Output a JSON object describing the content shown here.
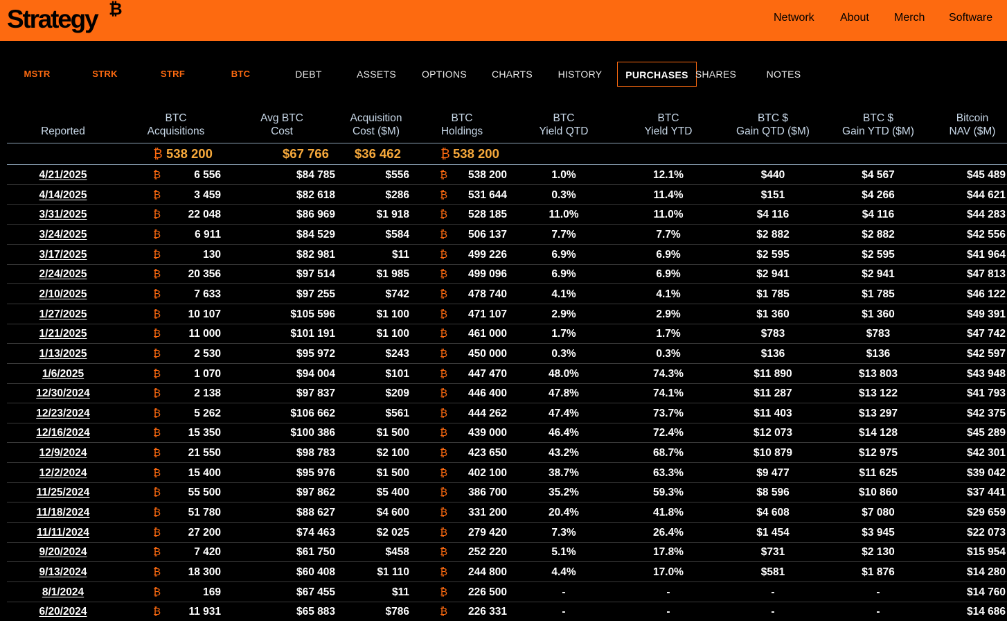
{
  "header": {
    "logo": "Strategy",
    "logo_mark": "₿",
    "nav": [
      "Network",
      "About",
      "Merch",
      "Software"
    ]
  },
  "tabs": [
    "MSTR",
    "STRK",
    "STRF",
    "BTC",
    "DEBT",
    "ASSETS",
    "OPTIONS",
    "CHARTS",
    "HISTORY",
    "PURCHASES",
    "SHARES",
    "NOTES"
  ],
  "active_tab": "PURCHASES",
  "columns": [
    {
      "l1": "",
      "l2": "Reported"
    },
    {
      "l1": "BTC",
      "l2": "Acquisitions"
    },
    {
      "l1": "Avg BTC",
      "l2": "Cost"
    },
    {
      "l1": "Acquisition",
      "l2": "Cost ($M)"
    },
    {
      "l1": "BTC",
      "l2": "Holdings"
    },
    {
      "l1": "BTC",
      "l2": "Yield QTD"
    },
    {
      "l1": "BTC",
      "l2": "Yield YTD"
    },
    {
      "l1": "BTC $",
      "l2": "Gain QTD ($M)"
    },
    {
      "l1": "BTC $",
      "l2": "Gain YTD ($M)"
    },
    {
      "l1": "Bitcoin",
      "l2": "NAV ($M)"
    }
  ],
  "totals": {
    "acquisitions": "538 200",
    "avg_cost": "$67 766",
    "acq_cost": "$36 462",
    "holdings": "538 200"
  },
  "btc_symbol": "₿",
  "rows": [
    [
      "4/21/2025",
      "6 556",
      "$84 785",
      "$556",
      "538 200",
      "1.0%",
      "12.1%",
      "$440",
      "$4 567",
      "$45 489"
    ],
    [
      "4/14/2025",
      "3 459",
      "$82 618",
      "$286",
      "531 644",
      "0.3%",
      "11.4%",
      "$151",
      "$4 266",
      "$44 621"
    ],
    [
      "3/31/2025",
      "22 048",
      "$86 969",
      "$1 918",
      "528 185",
      "11.0%",
      "11.0%",
      "$4 116",
      "$4 116",
      "$44 283"
    ],
    [
      "3/24/2025",
      "6 911",
      "$84 529",
      "$584",
      "506 137",
      "7.7%",
      "7.7%",
      "$2 882",
      "$2 882",
      "$42 556"
    ],
    [
      "3/17/2025",
      "130",
      "$82 981",
      "$11",
      "499 226",
      "6.9%",
      "6.9%",
      "$2 595",
      "$2 595",
      "$41 964"
    ],
    [
      "2/24/2025",
      "20 356",
      "$97 514",
      "$1 985",
      "499 096",
      "6.9%",
      "6.9%",
      "$2 941",
      "$2 941",
      "$47 813"
    ],
    [
      "2/10/2025",
      "7 633",
      "$97 255",
      "$742",
      "478 740",
      "4.1%",
      "4.1%",
      "$1 785",
      "$1 785",
      "$46 122"
    ],
    [
      "1/27/2025",
      "10 107",
      "$105 596",
      "$1 100",
      "471 107",
      "2.9%",
      "2.9%",
      "$1 360",
      "$1 360",
      "$49 391"
    ],
    [
      "1/21/2025",
      "11 000",
      "$101 191",
      "$1 100",
      "461 000",
      "1.7%",
      "1.7%",
      "$783",
      "$783",
      "$47 742"
    ],
    [
      "1/13/2025",
      "2 530",
      "$95 972",
      "$243",
      "450 000",
      "0.3%",
      "0.3%",
      "$136",
      "$136",
      "$42 597"
    ],
    [
      "1/6/2025",
      "1 070",
      "$94 004",
      "$101",
      "447 470",
      "48.0%",
      "74.3%",
      "$11 890",
      "$13 803",
      "$43 948"
    ],
    [
      "12/30/2024",
      "2 138",
      "$97 837",
      "$209",
      "446 400",
      "47.8%",
      "74.1%",
      "$11 287",
      "$13 122",
      "$41 793"
    ],
    [
      "12/23/2024",
      "5 262",
      "$106 662",
      "$561",
      "444 262",
      "47.4%",
      "73.7%",
      "$11 403",
      "$13 297",
      "$42 375"
    ],
    [
      "12/16/2024",
      "15 350",
      "$100 386",
      "$1 500",
      "439 000",
      "46.4%",
      "72.4%",
      "$12 073",
      "$14 128",
      "$45 289"
    ],
    [
      "12/9/2024",
      "21 550",
      "$98 783",
      "$2 100",
      "423 650",
      "43.2%",
      "68.7%",
      "$10 879",
      "$12 975",
      "$42 301"
    ],
    [
      "12/2/2024",
      "15 400",
      "$95 976",
      "$1 500",
      "402 100",
      "38.7%",
      "63.3%",
      "$9 477",
      "$11 625",
      "$39 042"
    ],
    [
      "11/25/2024",
      "55 500",
      "$97 862",
      "$5 400",
      "386 700",
      "35.2%",
      "59.3%",
      "$8 596",
      "$10 860",
      "$37 441"
    ],
    [
      "11/18/2024",
      "51 780",
      "$88 627",
      "$4 600",
      "331 200",
      "20.4%",
      "41.8%",
      "$4 608",
      "$7 080",
      "$29 659"
    ],
    [
      "11/11/2024",
      "27 200",
      "$74 463",
      "$2 025",
      "279 420",
      "7.3%",
      "26.4%",
      "$1 454",
      "$3 945",
      "$22 073"
    ],
    [
      "9/20/2024",
      "7 420",
      "$61 750",
      "$458",
      "252 220",
      "5.1%",
      "17.8%",
      "$731",
      "$2 130",
      "$15 954"
    ],
    [
      "9/13/2024",
      "18 300",
      "$60 408",
      "$1 110",
      "244 800",
      "4.4%",
      "17.0%",
      "$581",
      "$1 876",
      "$14 280"
    ],
    [
      "8/1/2024",
      "169",
      "$67 455",
      "$11",
      "226 500",
      "-",
      "-",
      "-",
      "-",
      "$14 760"
    ],
    [
      "6/20/2024",
      "11 931",
      "$65 883",
      "$786",
      "226 331",
      "-",
      "-",
      "-",
      "-",
      "$14 686"
    ]
  ]
}
